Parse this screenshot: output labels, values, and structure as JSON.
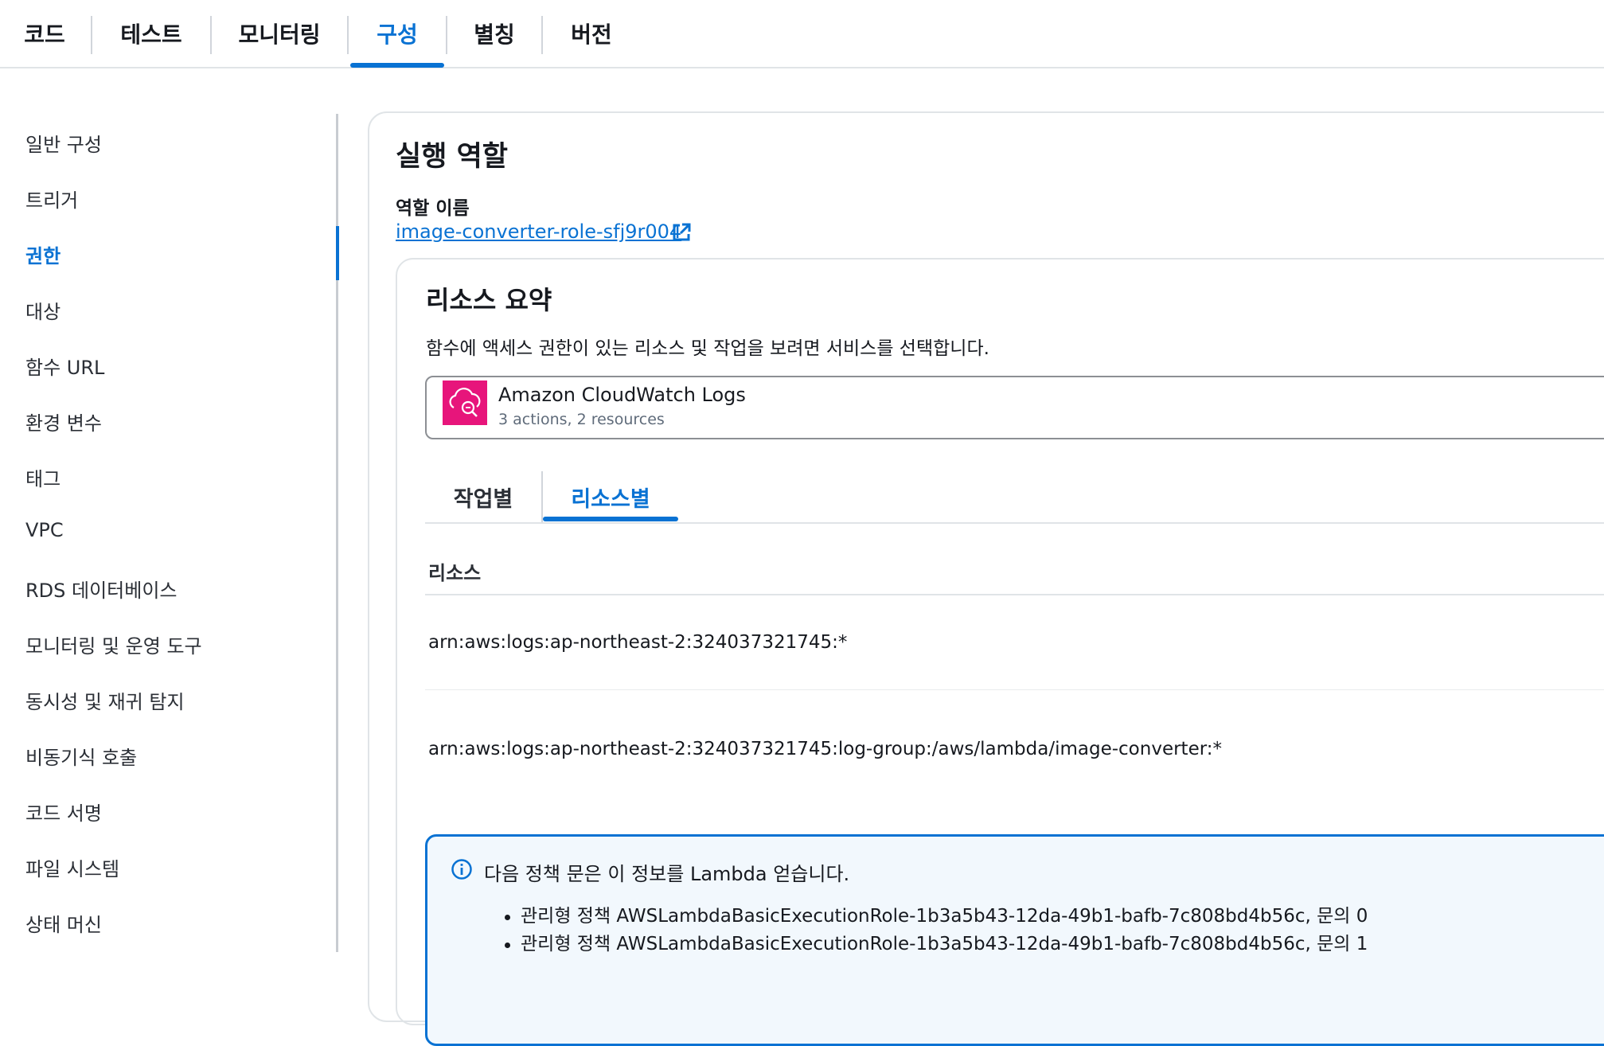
{
  "top_tabs": [
    {
      "label": "코드",
      "active": false
    },
    {
      "label": "테스트",
      "active": false
    },
    {
      "label": "모니터링",
      "active": false
    },
    {
      "label": "구성",
      "active": true
    },
    {
      "label": "별칭",
      "active": false
    },
    {
      "label": "버전",
      "active": false
    }
  ],
  "sidebar": {
    "items": [
      {
        "label": "일반 구성",
        "active": false
      },
      {
        "label": "트리거",
        "active": false
      },
      {
        "label": "권한",
        "active": true
      },
      {
        "label": "대상",
        "active": false
      },
      {
        "label": "함수 URL",
        "active": false
      },
      {
        "label": "환경 변수",
        "active": false
      },
      {
        "label": "태그",
        "active": false
      },
      {
        "label": "VPC",
        "active": false
      },
      {
        "label": "RDS 데이터베이스",
        "active": false
      },
      {
        "label": "모니터링 및 운영 도구",
        "active": false
      },
      {
        "label": "동시성 및 재귀 탐지",
        "active": false
      },
      {
        "label": "비동기식 호출",
        "active": false
      },
      {
        "label": "코드 서명",
        "active": false
      },
      {
        "label": "파일 시스템",
        "active": false
      },
      {
        "label": "상태 머신",
        "active": false
      }
    ]
  },
  "execution_role": {
    "title": "실행 역할",
    "role_name_label": "역할 이름",
    "role_name": "image-converter-role-sfj9r004"
  },
  "resource_summary": {
    "title": "리소스 요약",
    "description": "함수에 액세스 권한이 있는 리소스 및 작업을 보려면 서비스를 선택합니다.",
    "service": {
      "name": "Amazon CloudWatch Logs",
      "detail": "3 actions, 2 resources",
      "icon": "cloudwatch-logs-icon",
      "icon_color": "#e7157b"
    },
    "tabs": [
      {
        "label": "작업별",
        "active": false
      },
      {
        "label": "리소스별",
        "active": true
      }
    ],
    "table": {
      "header": "리소스",
      "rows": [
        "arn:aws:logs:ap-northeast-2:324037321745:*",
        "arn:aws:logs:ap-northeast-2:324037321745:log-group:/aws/lambda/image-converter:*"
      ]
    }
  },
  "info_box": {
    "title": "다음 정책 문은 이 정보를 Lambda 얻습니다.",
    "items": [
      "관리형 정책 AWSLambdaBasicExecutionRole-1b3a5b43-12da-49b1-bafb-7c808bd4b56c, 문의 0",
      "관리형 정책 AWSLambdaBasicExecutionRole-1b3a5b43-12da-49b1-bafb-7c808bd4b56c, 문의 1"
    ]
  },
  "colors": {
    "accent": "#0972d3",
    "text": "#16191f",
    "info_bg": "#f2f8fd"
  }
}
